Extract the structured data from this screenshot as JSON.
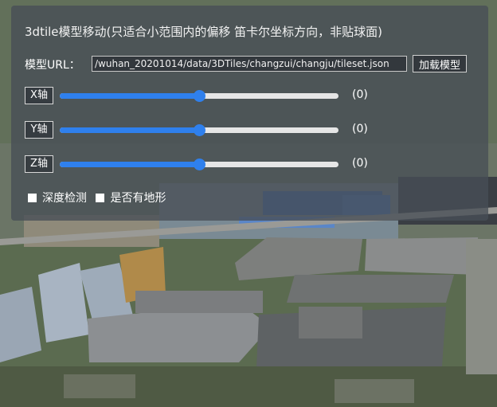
{
  "panel": {
    "title": "3dtile模型移动(只适合小范围内的偏移 笛卡尔坐标方向，非贴球面)",
    "url_label": "模型URL：",
    "url_value": "/wuhan_20201014/data/3DTiles/changzui/changju/tileset.json",
    "load_button": "加载模型",
    "axes": [
      {
        "label": "X轴",
        "value_text": "(0)",
        "fraction": 0.5
      },
      {
        "label": "Y轴",
        "value_text": "(0)",
        "fraction": 0.5
      },
      {
        "label": "Z轴",
        "value_text": "(0)",
        "fraction": 0.5
      }
    ],
    "checkboxes": [
      {
        "label": "深度检测",
        "checked": false
      },
      {
        "label": "是否有地形",
        "checked": false
      }
    ]
  },
  "colors": {
    "accent": "#2f80ed",
    "panel_bg": "rgba(72,78,86,0.78)"
  }
}
